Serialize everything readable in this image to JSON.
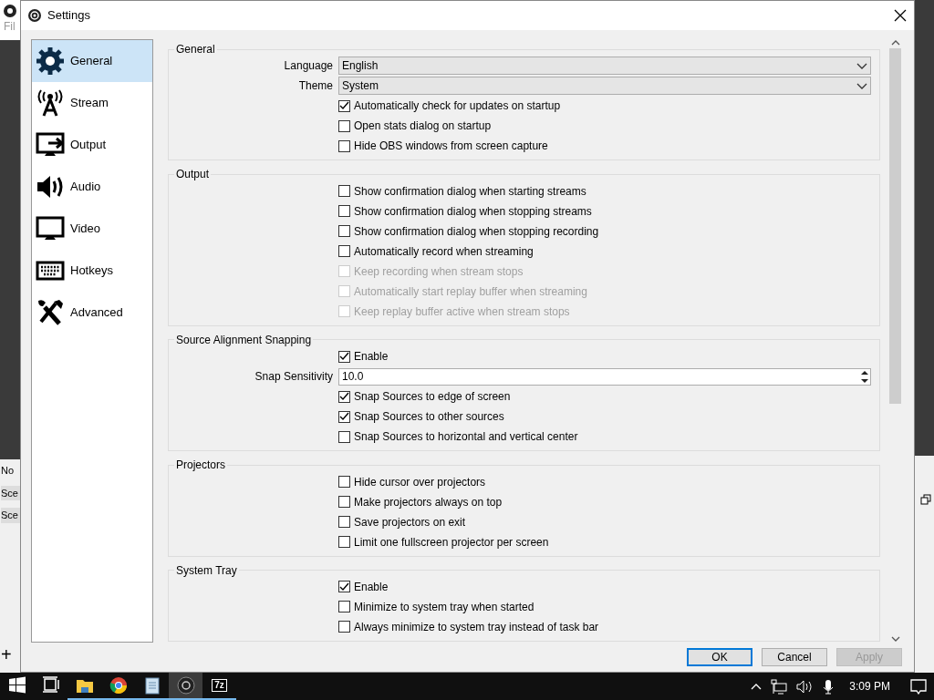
{
  "background_window": {
    "menu_text": "Fil",
    "labels": [
      "No",
      "Sce",
      "Sce"
    ],
    "add_button": "+"
  },
  "window": {
    "title": "Settings"
  },
  "sidebar": {
    "items": [
      {
        "label": "General",
        "kind": "gear",
        "selected": true
      },
      {
        "label": "Stream",
        "kind": "antenna",
        "selected": false
      },
      {
        "label": "Output",
        "kind": "output",
        "selected": false
      },
      {
        "label": "Audio",
        "kind": "speaker",
        "selected": false
      },
      {
        "label": "Video",
        "kind": "monitor",
        "selected": false
      },
      {
        "label": "Hotkeys",
        "kind": "keyboard",
        "selected": false
      },
      {
        "label": "Advanced",
        "kind": "tools",
        "selected": false
      }
    ]
  },
  "sections": [
    {
      "title": "General",
      "rows": [
        {
          "kind": "select",
          "label": "Language",
          "value": "English"
        },
        {
          "kind": "select",
          "label": "Theme",
          "value": "System"
        },
        {
          "kind": "checkbox",
          "label": "Automatically check for updates on startup",
          "checked": true,
          "disabled": false
        },
        {
          "kind": "checkbox",
          "label": "Open stats dialog on startup",
          "checked": false,
          "disabled": false
        },
        {
          "kind": "checkbox",
          "label": "Hide OBS windows from screen capture",
          "checked": false,
          "disabled": false
        }
      ]
    },
    {
      "title": "Output",
      "rows": [
        {
          "kind": "checkbox",
          "label": "Show confirmation dialog when starting streams",
          "checked": false,
          "disabled": false
        },
        {
          "kind": "checkbox",
          "label": "Show confirmation dialog when stopping streams",
          "checked": false,
          "disabled": false
        },
        {
          "kind": "checkbox",
          "label": "Show confirmation dialog when stopping recording",
          "checked": false,
          "disabled": false
        },
        {
          "kind": "checkbox",
          "label": "Automatically record when streaming",
          "checked": false,
          "disabled": false
        },
        {
          "kind": "checkbox",
          "label": "Keep recording when stream stops",
          "checked": false,
          "disabled": true
        },
        {
          "kind": "checkbox",
          "label": "Automatically start replay buffer when streaming",
          "checked": false,
          "disabled": true
        },
        {
          "kind": "checkbox",
          "label": "Keep replay buffer active when stream stops",
          "checked": false,
          "disabled": true
        }
      ]
    },
    {
      "title": "Source Alignment Snapping",
      "rows": [
        {
          "kind": "checkbox",
          "label": "Enable",
          "checked": true,
          "disabled": false
        },
        {
          "kind": "spin",
          "label": "Snap Sensitivity",
          "value": "10.0"
        },
        {
          "kind": "checkbox",
          "label": "Snap Sources to edge of screen",
          "checked": true,
          "disabled": false
        },
        {
          "kind": "checkbox",
          "label": "Snap Sources to other sources",
          "checked": true,
          "disabled": false
        },
        {
          "kind": "checkbox",
          "label": "Snap Sources to horizontal and vertical center",
          "checked": false,
          "disabled": false
        }
      ]
    },
    {
      "title": "Projectors",
      "rows": [
        {
          "kind": "checkbox",
          "label": "Hide cursor over projectors",
          "checked": false,
          "disabled": false
        },
        {
          "kind": "checkbox",
          "label": "Make projectors always on top",
          "checked": false,
          "disabled": false
        },
        {
          "kind": "checkbox",
          "label": "Save projectors on exit",
          "checked": false,
          "disabled": false
        },
        {
          "kind": "checkbox",
          "label": "Limit one fullscreen projector per screen",
          "checked": false,
          "disabled": false
        }
      ]
    },
    {
      "title": "System Tray",
      "rows": [
        {
          "kind": "checkbox",
          "label": "Enable",
          "checked": true,
          "disabled": false
        },
        {
          "kind": "checkbox",
          "label": "Minimize to system tray when started",
          "checked": false,
          "disabled": false
        },
        {
          "kind": "checkbox",
          "label": "Always minimize to system tray instead of task bar",
          "checked": false,
          "disabled": false
        }
      ]
    }
  ],
  "buttons": [
    {
      "label": "OK",
      "default": true,
      "disabled": false
    },
    {
      "label": "Cancel",
      "default": false,
      "disabled": false
    },
    {
      "label": "Apply",
      "default": false,
      "disabled": true
    }
  ],
  "taskbar": {
    "apps": [
      {
        "kind": "start",
        "running": false,
        "selected": false
      },
      {
        "kind": "taskview",
        "running": false,
        "selected": false
      },
      {
        "kind": "explorer",
        "running": true,
        "selected": false
      },
      {
        "kind": "chrome",
        "running": true,
        "selected": false
      },
      {
        "kind": "notepad",
        "running": true,
        "selected": false
      },
      {
        "kind": "obs",
        "running": true,
        "selected": true
      },
      {
        "kind": "archiver",
        "icon_text": "7z",
        "running": true,
        "selected": false
      }
    ],
    "clock": "3:09 PM"
  }
}
